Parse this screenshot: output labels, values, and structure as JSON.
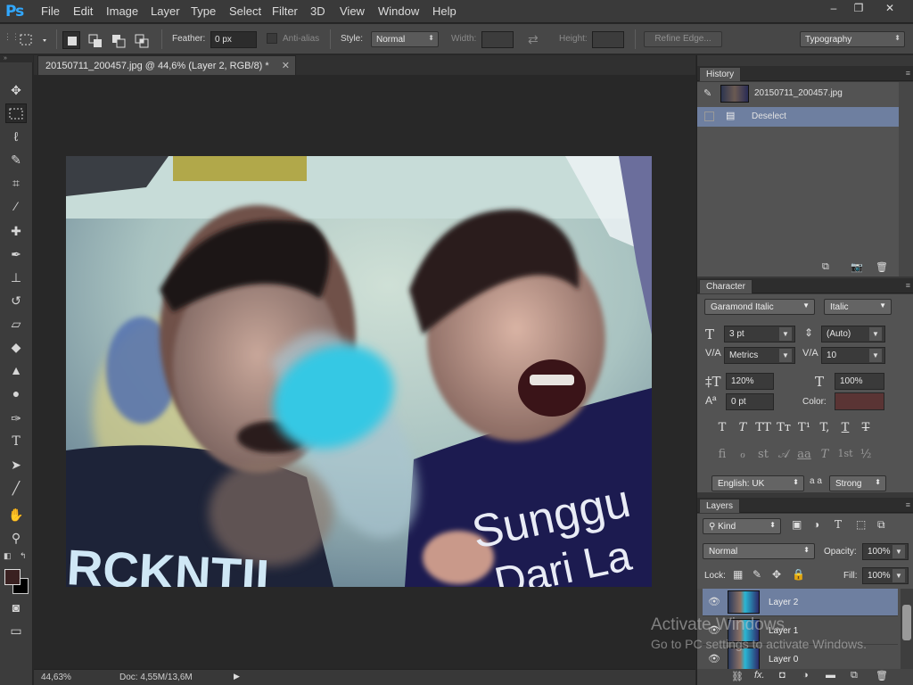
{
  "app": {
    "logo": "Ps",
    "menu": [
      "File",
      "Edit",
      "Image",
      "Layer",
      "Type",
      "Select",
      "Filter",
      "3D",
      "View",
      "Window",
      "Help"
    ],
    "window_controls": [
      "–",
      "❐",
      "✕"
    ]
  },
  "options": {
    "feather_label": "Feather:",
    "feather_value": "0 px",
    "antialias_label": "Anti-alias",
    "style_label": "Style:",
    "style_value": "Normal",
    "width_label": "Width:",
    "height_label": "Height:",
    "refine_edge": "Refine Edge...",
    "workspace": "Typography"
  },
  "document": {
    "tab_title": "20150711_200457.jpg @ 44,6% (Layer 2, RGB/8) *",
    "zoom": "44,63%",
    "doc_size": "Doc: 4,55M/13,6M",
    "photo_text": {
      "left_shirt": "RCKNTIL",
      "right_shirt_1": "Sunggu",
      "right_shirt_2": "Dari La"
    }
  },
  "history": {
    "tab": "History",
    "snapshot": "20150711_200457.jpg",
    "items": [
      "Deselect"
    ]
  },
  "character": {
    "tab": "Character",
    "font_family": "Garamond Italic",
    "font_style": "Italic",
    "size": "3 pt",
    "leading": "(Auto)",
    "kerning": "Metrics",
    "tracking": "10",
    "vscale": "120%",
    "hscale": "100%",
    "baseline": "0 pt",
    "color_label": "Color:",
    "color_value": "#5a3434",
    "language": "English: UK",
    "aa_icon": "a a",
    "antialias": "Strong",
    "style_glyphs": [
      "T",
      "T",
      "TT",
      "Tт",
      "T¹",
      "T,",
      "T",
      "T"
    ],
    "ot_glyphs": [
      "fi",
      "ℴ",
      "st",
      "𝒜",
      "aa",
      "T",
      "1st",
      "½"
    ]
  },
  "layers": {
    "tab": "Layers",
    "kind_label": "Kind",
    "blend_mode": "Normal",
    "opacity_label": "Opacity:",
    "opacity": "100%",
    "lock_label": "Lock:",
    "fill_label": "Fill:",
    "fill": "100%",
    "rows": [
      {
        "name": "Layer 2",
        "selected": true
      },
      {
        "name": "Layer 1",
        "selected": false
      },
      {
        "name": "Layer 0",
        "selected": false
      }
    ]
  },
  "watermark": {
    "title": "Activate Windows",
    "subtitle": "Go to PC settings to activate Windows."
  },
  "colors": {
    "accent": "#31a8ff",
    "selection": "#6e7fa0",
    "panel": "#535353"
  }
}
